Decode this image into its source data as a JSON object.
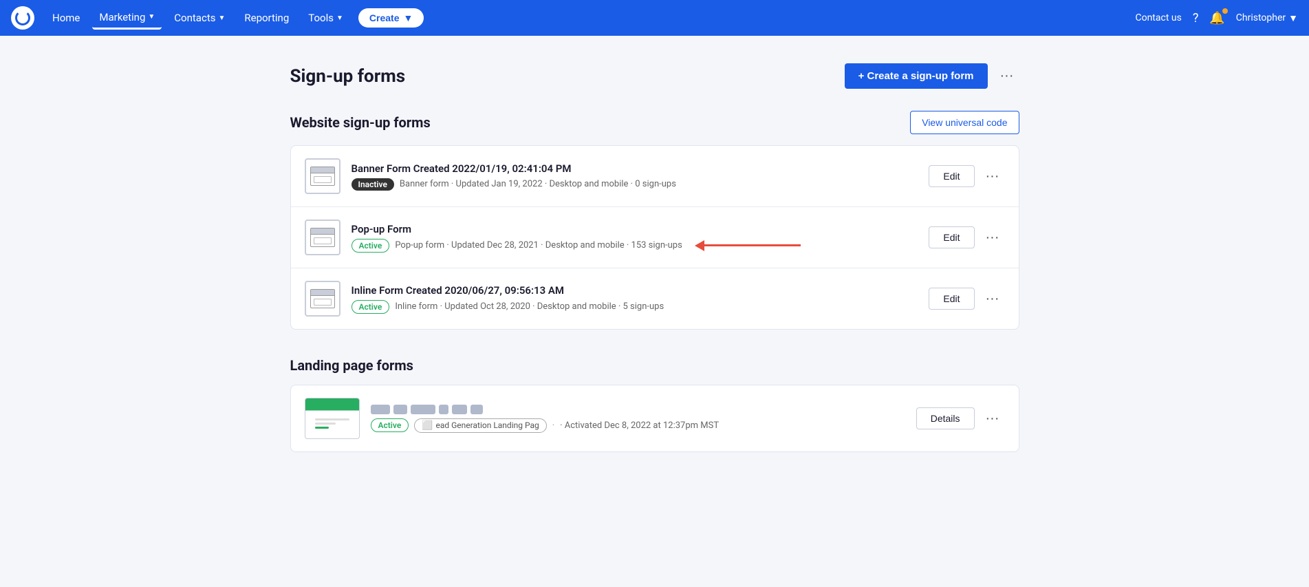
{
  "navbar": {
    "logo_alt": "Campaign Monitor logo",
    "items": [
      {
        "label": "Home",
        "hasDropdown": false,
        "active": false
      },
      {
        "label": "Marketing",
        "hasDropdown": true,
        "active": true
      },
      {
        "label": "Contacts",
        "hasDropdown": true,
        "active": false
      },
      {
        "label": "Reporting",
        "hasDropdown": false,
        "active": false
      },
      {
        "label": "Tools",
        "hasDropdown": true,
        "active": false
      }
    ],
    "create_label": "Create",
    "contact_us_label": "Contact us",
    "user_label": "Christopher"
  },
  "page": {
    "title": "Sign-up forms",
    "create_form_label": "+ Create a sign-up form",
    "more_icon": "···"
  },
  "website_section": {
    "title": "Website sign-up forms",
    "view_universal_label": "View universal code",
    "forms": [
      {
        "name": "Banner Form Created 2022/01/19, 02:41:04 PM",
        "status": "Inactive",
        "status_type": "inactive",
        "meta": "Banner form · Updated Jan 19, 2022 · Desktop and mobile · 0 sign-ups",
        "action_label": "Edit"
      },
      {
        "name": "Pop-up Form",
        "status": "Active",
        "status_type": "active",
        "meta": "Pop-up form · Updated Dec 28, 2021 · Desktop and mobile · 153 sign-ups",
        "action_label": "Edit",
        "has_arrow": true
      },
      {
        "name": "Inline Form Created 2020/06/27, 09:56:13 AM",
        "status": "Active",
        "status_type": "active",
        "meta": "Inline form · Updated Oct 28, 2020 · Desktop and mobile · 5 sign-ups",
        "action_label": "Edit"
      }
    ]
  },
  "landing_section": {
    "title": "Landing page forms",
    "forms": [
      {
        "name_blurred": true,
        "status": "Active",
        "status_type": "active",
        "page_tag": "ead Generation Landing Pag",
        "meta_suffix": "· Activated Dec 8, 2022 at 12:37pm MST",
        "action_label": "Details"
      }
    ]
  }
}
